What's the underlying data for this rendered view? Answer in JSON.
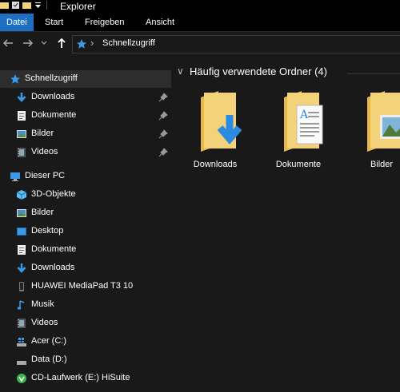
{
  "window": {
    "title": "Explorer"
  },
  "ribbon": {
    "tabs": [
      "Datei",
      "Start",
      "Freigeben",
      "Ansicht"
    ]
  },
  "address": {
    "path": "Schnellzugriff"
  },
  "sidebar": {
    "quick_access": "Schnellzugriff",
    "pinned": [
      "Downloads",
      "Dokumente",
      "Bilder",
      "Videos"
    ],
    "this_pc": "Dieser PC",
    "pc_items": [
      "3D-Objekte",
      "Bilder",
      "Desktop",
      "Dokumente",
      "Downloads",
      "HUAWEI MediaPad T3 10",
      "Musik",
      "Videos",
      "Acer (C:)",
      "Data (D:)",
      "CD-Laufwerk (E:) HiSuite"
    ]
  },
  "main": {
    "group_title": "Häufig verwendete Ordner (4)",
    "folders": [
      "Downloads",
      "Dokumente",
      "Bilder"
    ]
  },
  "colors": {
    "accent": "#1e6fc4",
    "folder": "#f3d27a",
    "background": "#191919"
  }
}
